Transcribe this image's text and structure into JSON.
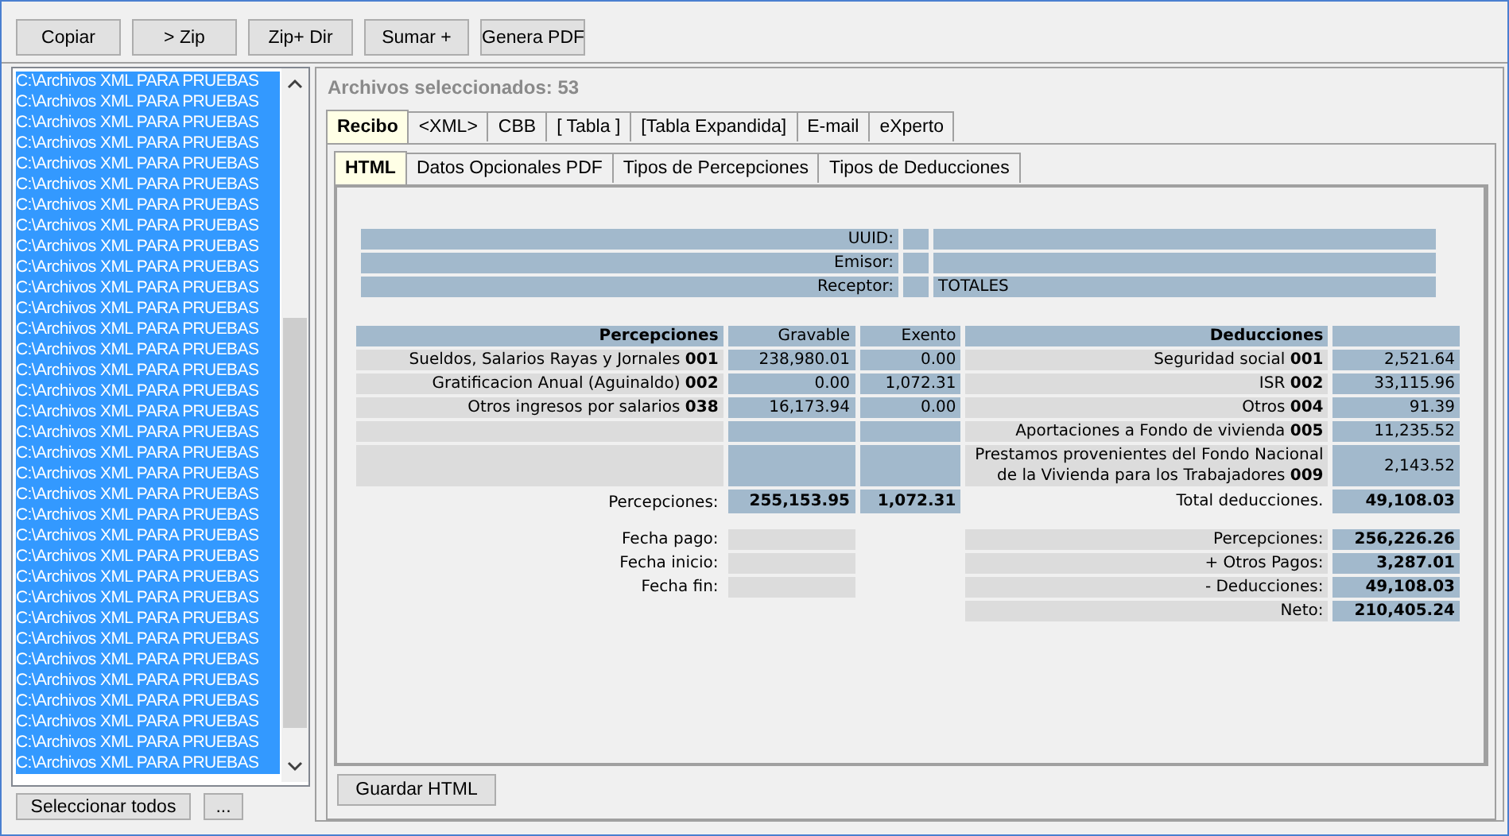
{
  "toolbar": [
    "Copiar",
    "> Zip",
    "Zip+ Dir",
    "Sumar +",
    "Genera PDF"
  ],
  "file_list": {
    "items": [
      "C:\\Archivos XML PARA PRUEBAS",
      "C:\\Archivos XML PARA PRUEBAS",
      "C:\\Archivos XML PARA PRUEBAS",
      "C:\\Archivos XML PARA PRUEBAS",
      "C:\\Archivos XML PARA PRUEBAS",
      "C:\\Archivos XML PARA PRUEBAS",
      "C:\\Archivos XML PARA PRUEBAS",
      "C:\\Archivos XML PARA PRUEBAS",
      "C:\\Archivos XML PARA PRUEBAS",
      "C:\\Archivos XML PARA PRUEBAS",
      "C:\\Archivos XML PARA PRUEBAS",
      "C:\\Archivos XML PARA PRUEBAS",
      "C:\\Archivos XML PARA PRUEBAS",
      "C:\\Archivos XML PARA PRUEBAS",
      "C:\\Archivos XML PARA PRUEBAS",
      "C:\\Archivos XML PARA PRUEBAS",
      "C:\\Archivos XML PARA PRUEBAS",
      "C:\\Archivos XML PARA PRUEBAS",
      "C:\\Archivos XML PARA PRUEBAS",
      "C:\\Archivos XML PARA PRUEBAS",
      "C:\\Archivos XML PARA PRUEBAS",
      "C:\\Archivos XML PARA PRUEBAS",
      "C:\\Archivos XML PARA PRUEBAS",
      "C:\\Archivos XML PARA PRUEBAS",
      "C:\\Archivos XML PARA PRUEBAS",
      "C:\\Archivos XML PARA PRUEBAS",
      "C:\\Archivos XML PARA PRUEBAS",
      "C:\\Archivos XML PARA PRUEBAS",
      "C:\\Archivos XML PARA PRUEBAS",
      "C:\\Archivos XML PARA PRUEBAS",
      "C:\\Archivos XML PARA PRUEBAS",
      "C:\\Archivos XML PARA PRUEBAS",
      "C:\\Archivos XML PARA PRUEBAS",
      "C:\\Archivos XML PARA PRUEBAS"
    ],
    "all_selected": true,
    "buttons": [
      "Seleccionar todos",
      "..."
    ]
  },
  "selected_count": "Archivos seleccionados: 53",
  "tabs": [
    {
      "label": "Recibo",
      "selected": true
    },
    {
      "label": "<XML>",
      "selected": false
    },
    {
      "label": "CBB",
      "selected": false
    },
    {
      "label": "[ Tabla ]",
      "selected": false
    },
    {
      "label": "[Tabla Expandida]",
      "selected": false
    },
    {
      "label": "E-mail",
      "selected": false
    },
    {
      "label": "eXperto",
      "selected": false
    }
  ],
  "subtabs": [
    {
      "label": "HTML",
      "selected": true
    },
    {
      "label": "Datos Opcionales PDF",
      "selected": false
    },
    {
      "label": "Tipos de Percepciones",
      "selected": false
    },
    {
      "label": "Tipos de Deducciones",
      "selected": false
    }
  ],
  "info": [
    {
      "label": "UUID:"
    },
    {
      "label": "Emisor:"
    },
    {
      "label": "Receptor:",
      "value": "TOTALES"
    }
  ],
  "percepciones": {
    "title": "Percepciones",
    "columns": [
      "Gravable",
      "Exento"
    ],
    "rows": [
      {
        "concept": "Sueldos, Salarios Rayas y Jornales **001**",
        "gravable": "238,980.01",
        "exento": "0.00"
      },
      {
        "concept": "Gratificacion Anual (Aguinaldo) **002**",
        "gravable": "0.00",
        "exento": "1,072.31"
      },
      {
        "concept": "Otros ingresos por salarios **038**",
        "gravable": "16,173.94",
        "exento": "0.00"
      }
    ],
    "total_label": "Percepciones:",
    "total_gravable": "255,153.95",
    "total_exento": "1,072.31"
  },
  "deducciones": {
    "title": "Deducciones",
    "rows": [
      {
        "concept": "Seguridad social **001**",
        "amount": "2,521.64"
      },
      {
        "concept": "ISR **002**",
        "amount": "33,115.96"
      },
      {
        "concept": "Otros **004**",
        "amount": "91.39"
      },
      {
        "concept": "Aportaciones a Fondo de vivienda **005**",
        "amount": "11,235.52"
      },
      {
        "concept": "Prestamos provenientes del Fondo Nacional de la Vivienda para los Trabajadores **009**",
        "amount": "2,143.52"
      }
    ],
    "total_label": "Total deducciones.",
    "total": "49,108.03"
  },
  "fechas": [
    {
      "label": "Fecha pago:"
    },
    {
      "label": "Fecha inicio:"
    },
    {
      "label": "Fecha fin:"
    }
  ],
  "resumen": [
    {
      "label": "Percepciones:",
      "value": "256,226.26"
    },
    {
      "label": "+ Otros Pagos:",
      "value": "3,287.01"
    },
    {
      "label": "- Deducciones:",
      "value": "49,108.03"
    },
    {
      "label": "Neto:",
      "value": "210,405.24"
    }
  ],
  "save_button": "Guardar HTML"
}
